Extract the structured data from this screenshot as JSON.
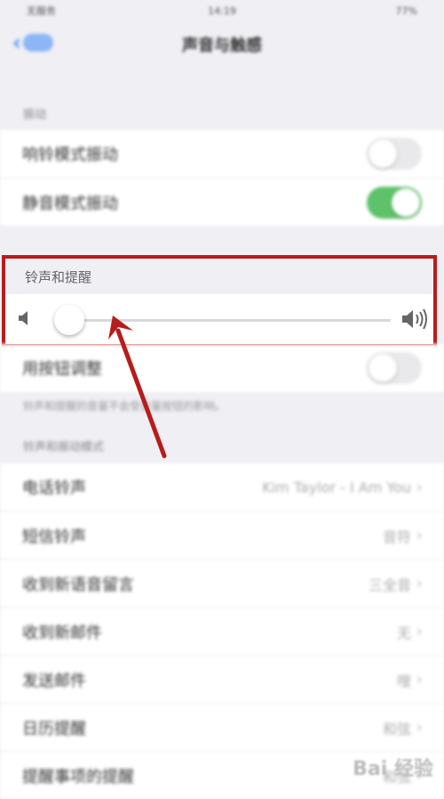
{
  "status": {
    "carrier": "无服务",
    "time": "14:19",
    "battery": "77%"
  },
  "nav": {
    "title": "声音与触感"
  },
  "vibrate": {
    "label": "振动",
    "rows": [
      {
        "label": "响铃模式振动",
        "on": false
      },
      {
        "label": "静音模式振动",
        "on": true
      }
    ]
  },
  "ringer": {
    "header": "铃声和提醒",
    "level": 0.03
  },
  "buttons_row": {
    "label": "用按钮调整",
    "on": false
  },
  "ringer_note": "铃声和提醒的音量不会受音量按钮的影响。",
  "patterns": {
    "label": "铃声和振动模式",
    "rows": [
      {
        "label": "电话铃声",
        "value": "Kim Taylor - I Am You"
      },
      {
        "label": "短信铃声",
        "value": "音符"
      },
      {
        "label": "收到新语音留言",
        "value": "三全音"
      },
      {
        "label": "收到新邮件",
        "value": "无"
      },
      {
        "label": "发送邮件",
        "value": "嗖"
      },
      {
        "label": "日历提醒",
        "value": "和弦"
      },
      {
        "label": "提醒事项的提醒",
        "value": "和弦"
      }
    ]
  },
  "watermark": "Bai 经验",
  "colors": {
    "highlight": "#b71c1c",
    "toggle_on": "#5ec26a",
    "accent": "#4a90f5"
  }
}
